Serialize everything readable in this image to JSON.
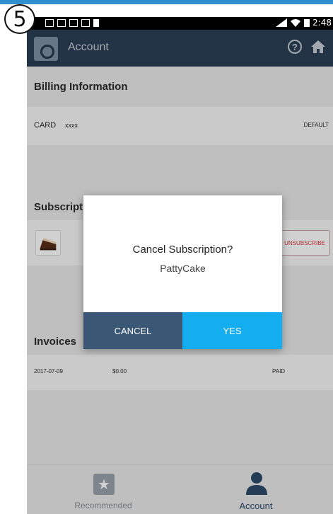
{
  "step": "5",
  "status_bar": {
    "time": "2:48"
  },
  "app_bar": {
    "title": "Account"
  },
  "billing": {
    "title": "Billing Information",
    "card_label": "CARD",
    "card_number": "xxxx",
    "card_tag": "DEFAULT"
  },
  "subscriptions": {
    "title": "Subscripti",
    "item": {
      "action": "UNSUBSCRIBE"
    }
  },
  "invoices": {
    "title": "Invoices",
    "rows": [
      {
        "date": "2017-07-09",
        "amount": "$0.00",
        "status": "PAID"
      }
    ]
  },
  "bottom_nav": {
    "items": [
      {
        "label": "Recommended",
        "active": false
      },
      {
        "label": "Account",
        "active": true
      }
    ]
  },
  "dialog": {
    "title": "Cancel Subscription?",
    "subtitle": "PattyCake",
    "cancel_label": "CANCEL",
    "confirm_label": "YES"
  },
  "colors": {
    "app_bar": "#2a3f55",
    "accent": "#14aef0",
    "cancel_button": "#3a5775",
    "unsubscribe_text": "#d63b3b"
  }
}
